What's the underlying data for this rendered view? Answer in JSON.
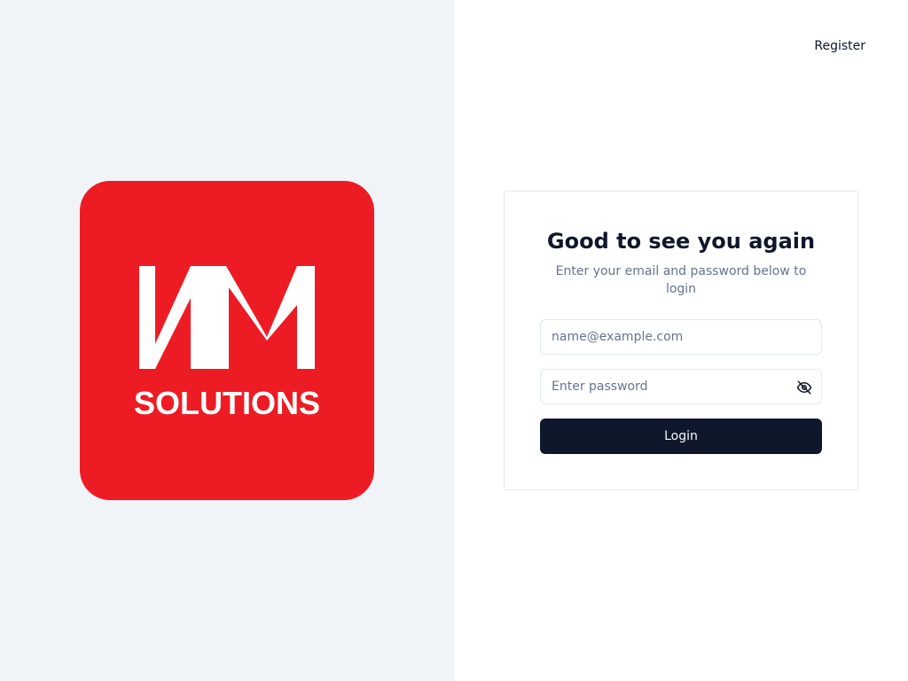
{
  "brand": {
    "logo_text": "WM",
    "logo_subtext": "SOLUTIONS",
    "logo_color": "#ed1c24",
    "logo_icon": "wm-solutions-logo"
  },
  "header": {
    "register_label": "Register"
  },
  "login_card": {
    "title": "Good to see you again",
    "subtitle": "Enter your email and password below to login",
    "email_placeholder": "name@example.com",
    "password_placeholder": "Enter password",
    "password_toggle_icon": "eye-off-icon",
    "login_label": "Login"
  },
  "colors": {
    "left_panel_bg": "#f0f3f8",
    "primary_button": "#0f172a",
    "muted_text": "#64748b",
    "border": "#e2e8f0"
  }
}
